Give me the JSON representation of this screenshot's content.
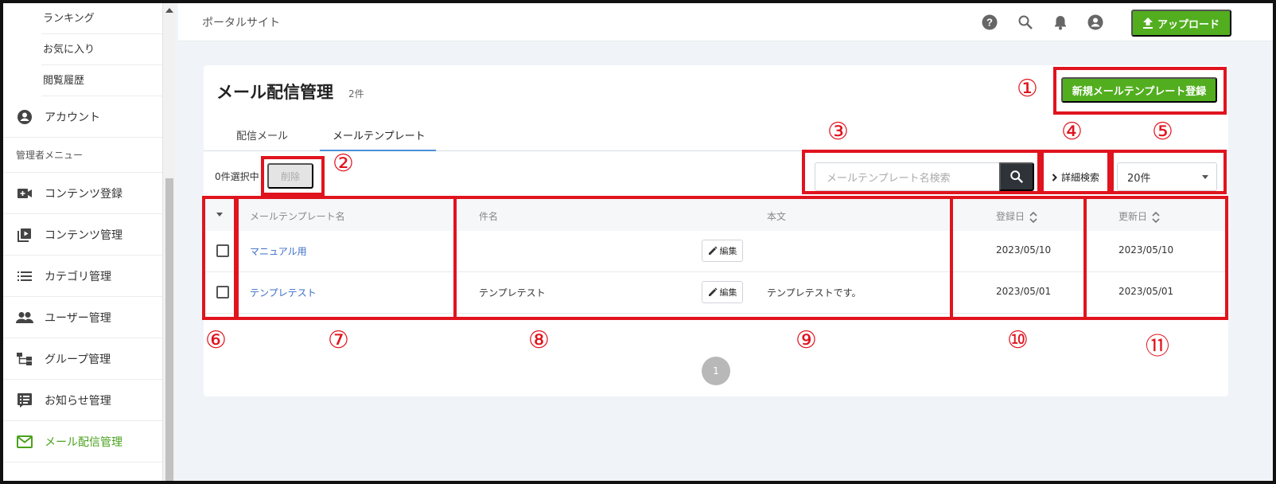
{
  "sidebar": {
    "sub_items": [
      "ランキング",
      "お気に入り",
      "閲覧履歴"
    ],
    "account_label": "アカウント",
    "section_label": "管理者メニュー",
    "admin_items": [
      {
        "label": "コンテンツ登録",
        "icon": "video-add-icon"
      },
      {
        "label": "コンテンツ管理",
        "icon": "video-library-icon"
      },
      {
        "label": "カテゴリ管理",
        "icon": "list-icon"
      },
      {
        "label": "ユーザー管理",
        "icon": "people-icon"
      },
      {
        "label": "グループ管理",
        "icon": "hierarchy-icon"
      },
      {
        "label": "お知らせ管理",
        "icon": "notice-icon"
      },
      {
        "label": "メール配信管理",
        "icon": "mail-icon",
        "active": true
      }
    ]
  },
  "header": {
    "site_title": "ポータルサイト",
    "upload_label": "アップロード"
  },
  "page": {
    "title": "メール配信管理",
    "count": "2件",
    "new_button": "新規メールテンプレート登録",
    "tabs": [
      "配信メール",
      "メールテンプレート"
    ],
    "active_tab": 1,
    "selected_text": "0件選択中",
    "delete_label": "削除",
    "search_placeholder": "メールテンプレート名検索",
    "advanced_search": "詳細検索",
    "per_page": "20件"
  },
  "table": {
    "headers": {
      "name": "メールテンプレート名",
      "subject": "件名",
      "body": "本文",
      "created": "登録日",
      "updated": "更新日"
    },
    "edit_label": "編集",
    "rows": [
      {
        "name": "マニュアル用",
        "subject": "",
        "body": "",
        "created": "2023/05/10",
        "updated": "2023/05/10"
      },
      {
        "name": "テンプレテスト",
        "subject": "テンプレテスト",
        "body": "テンプレテストです。",
        "created": "2023/05/01",
        "updated": "2023/05/01"
      }
    ]
  },
  "pagination": {
    "current": "1"
  },
  "annotations": [
    "①",
    "②",
    "③",
    "④",
    "⑤",
    "⑥",
    "⑦",
    "⑧",
    "⑨",
    "⑩",
    "⑪"
  ],
  "colors": {
    "brand_green": "#52ae1f",
    "annotation_red": "#e0141e",
    "link_blue": "#3c6ec6"
  }
}
